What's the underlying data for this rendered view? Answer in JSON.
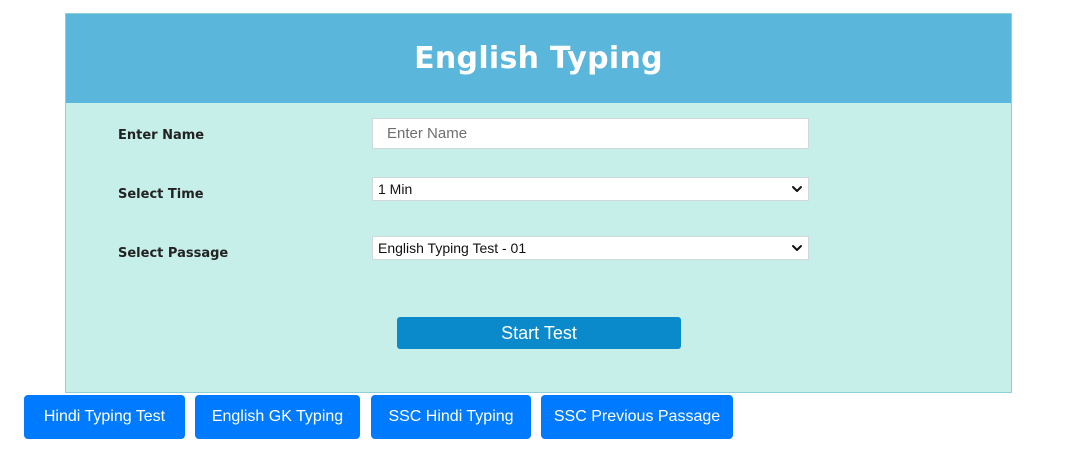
{
  "header": {
    "title": "English Typing"
  },
  "form": {
    "name_label": "Enter Name",
    "name_placeholder": "Enter Name",
    "name_value": "",
    "time_label": "Select Time",
    "time_selected": "1 Min",
    "passage_label": "Select Passage",
    "passage_selected": "English Typing Test - 01",
    "start_label": "Start Test"
  },
  "nav": [
    {
      "label": "Hindi Typing Test"
    },
    {
      "label": "English GK Typing"
    },
    {
      "label": "SSC Hindi Typing"
    },
    {
      "label": "SSC Previous Passage"
    }
  ],
  "icons": {
    "select_arrow": "chevron-down-icon"
  },
  "colors": {
    "header_bg": "#5ab6da",
    "card_bg": "#c6efea",
    "start_button": "#0a8acb",
    "nav_button": "#007bff"
  }
}
